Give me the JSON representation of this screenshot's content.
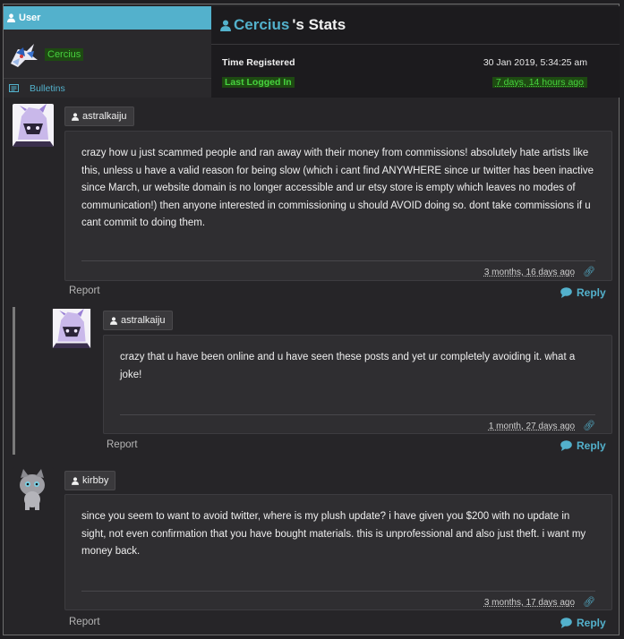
{
  "user_panel": {
    "header": "User",
    "username": "Cercius",
    "bulletins_label": "Bulletins"
  },
  "stats": {
    "title_name": "Cercius",
    "title_suffix": "'s Stats",
    "rows": [
      {
        "label": "Time Registered",
        "value": "30 Jan 2019, 5:34:25 am"
      },
      {
        "label": "Last Logged In",
        "value": "7 days, 14 hours ago"
      }
    ]
  },
  "comments": [
    {
      "author": "astralkaiju",
      "text": "crazy how u just scammed people and ran away with their money from commissions! absolutely hate artists like this, unless u have a valid reason for being slow (which i cant find ANYWHERE since ur twitter has been inactive since March, ur website domain is no longer accessible and ur etsy store is empty which leaves no modes of communication!) then anyone interested in commissioning u should AVOID doing so. dont take commissions if u cant commit to doing them.",
      "time": "3 months, 16 days ago",
      "report": "Report",
      "reply": "Reply"
    },
    {
      "author": "astralkaiju",
      "text": "crazy that u have been online and u have seen these posts and yet ur completely avoiding it. what a joke!",
      "time": "1 month, 27 days ago",
      "report": "Report",
      "reply": "Reply"
    },
    {
      "author": "kirbby",
      "text": "since you seem to want to avoid twitter, where is my plush update? i have given you $200 with no update in sight, not even confirmation that you have bought materials. this is unprofessional and also just theft. i want my money back.",
      "time": "3 months, 17 days ago",
      "report": "Report",
      "reply": "Reply"
    }
  ],
  "colors": {
    "accent": "#53b1cc",
    "online_green": "#47d13f",
    "panel_bg": "#2f2e31",
    "page_bg": "#262528"
  },
  "icons": {
    "user": "user-icon",
    "bulletins": "newspaper-icon",
    "permalink": "link-icon",
    "reply": "speech-bubble-icon"
  }
}
